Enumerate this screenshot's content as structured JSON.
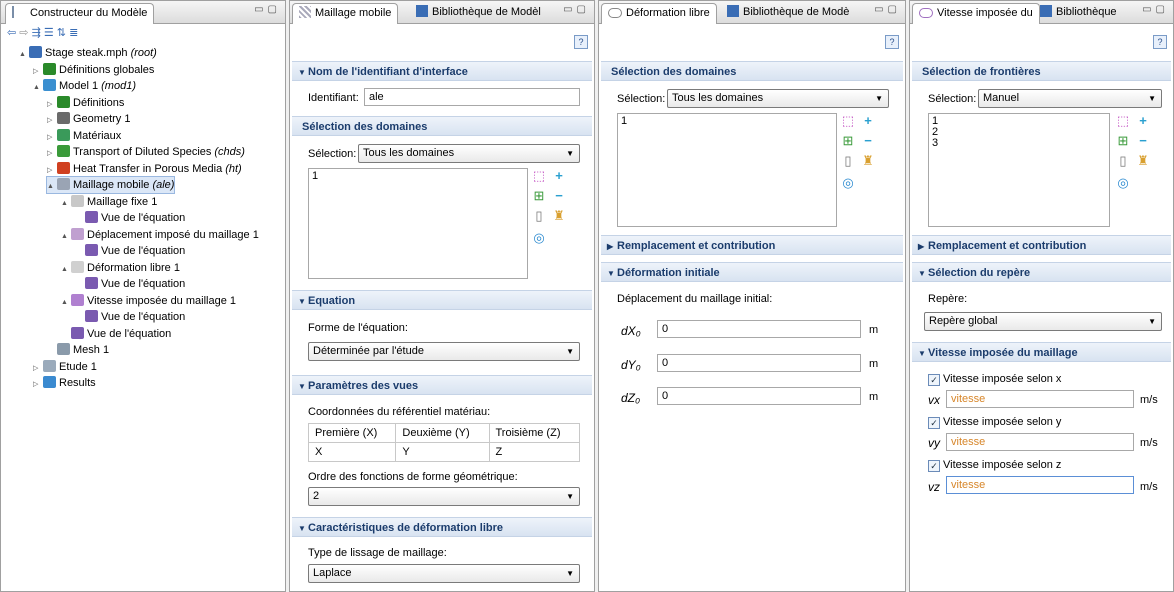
{
  "builder": {
    "title": "Constructeur du Modèle",
    "toolbar_icons": [
      "back-arrow-icon",
      "forward-arrow-icon",
      "expand-icon",
      "collapse-icon",
      "sort-icon",
      "list-icon"
    ],
    "tree": [
      {
        "label": "Stage steak.mph",
        "tag": "(root)",
        "icon": "mph-file-icon"
      },
      {
        "label": "Définitions globales",
        "tag": "",
        "icon": "definitions-icon"
      },
      {
        "label": "Model 1",
        "tag": "(mod1)",
        "icon": "model-icon"
      },
      {
        "label": "Définitions",
        "tag": "",
        "icon": "definitions-icon"
      },
      {
        "label": "Geometry 1",
        "tag": "",
        "icon": "geometry-icon"
      },
      {
        "label": "Matériaux",
        "tag": "",
        "icon": "materials-icon"
      },
      {
        "label": "Transport of Diluted Species",
        "tag": "(chds)",
        "icon": "transport-icon"
      },
      {
        "label": "Heat Transfer in Porous Media",
        "tag": "(ht)",
        "icon": "heat-transfer-icon"
      },
      {
        "label": "Maillage mobile",
        "tag": "(ale)",
        "icon": "moving-mesh-icon"
      },
      {
        "label": "Maillage fixe 1",
        "tag": "",
        "icon": "fixed-mesh-icon"
      },
      {
        "label": "Vue de l'équation",
        "tag": "",
        "icon": "equation-icon"
      },
      {
        "label": "Déplacement imposé du maillage 1",
        "tag": "",
        "icon": "displacement-icon"
      },
      {
        "label": "Vue de l'équation",
        "tag": "",
        "icon": "equation-icon"
      },
      {
        "label": "Déformation libre 1",
        "tag": "",
        "icon": "free-deformation-icon"
      },
      {
        "label": "Vue de l'équation",
        "tag": "",
        "icon": "equation-icon"
      },
      {
        "label": "Vitesse imposée du maillage 1",
        "tag": "",
        "icon": "velocity-icon"
      },
      {
        "label": "Vue de l'équation",
        "tag": "",
        "icon": "equation-icon"
      },
      {
        "label": "Vue de l'équation",
        "tag": "",
        "icon": "equation-icon"
      },
      {
        "label": "Mesh 1",
        "tag": "",
        "icon": "mesh-icon"
      },
      {
        "label": "Etude 1",
        "tag": "",
        "icon": "study-icon"
      },
      {
        "label": "Results",
        "tag": "",
        "icon": "results-icon"
      }
    ]
  },
  "pane2": {
    "tab_active": "Maillage mobile",
    "tab_other": "Bibliothèque de Modèl",
    "sec_interface": "Nom de l'identifiant d'interface",
    "ident_label": "Identifiant:",
    "ident_value": "ale",
    "sec_domains": "Sélection des domaines",
    "sel_label": "Sélection:",
    "sel_value": "Tous les domaines",
    "domains": "1",
    "sec_equation": "Equation",
    "form_label": "Forme de l'équation:",
    "form_value": "Déterminée par l'étude",
    "sec_params": "Paramètres des vues",
    "coord_label": "Coordonnées du référentiel matériau:",
    "coord_headers": [
      "Première (X)",
      "Deuxième (Y)",
      "Troisième (Z)"
    ],
    "coord_values": [
      "X",
      "Y",
      "Z"
    ],
    "order_label": "Ordre des fonctions de forme géométrique:",
    "order_value": "2",
    "sec_free": "Caractéristiques de déformation libre",
    "smooth_label": "Type de lissage de maillage:",
    "smooth_value": "Laplace"
  },
  "pane3": {
    "tab_active": "Déformation libre",
    "tab_other": "Bibliothèque de Modè",
    "sec_domains": "Sélection des domaines",
    "sel_label": "Sélection:",
    "sel_value": "Tous les domaines",
    "domains": "1",
    "sec_replace": "Remplacement et contribution",
    "sec_initial": "Déformation initiale",
    "disp_label": "Déplacement du maillage initial:",
    "dx_label": "dX₀",
    "dy_label": "dY₀",
    "dz_label": "dZ₀",
    "dx": "0",
    "dy": "0",
    "dz": "0",
    "unit": "m"
  },
  "pane4": {
    "tab_active": "Vitesse imposée du",
    "tab_other": "Bibliothèque",
    "sec_boundaries": "Sélection de frontières",
    "sel_label": "Sélection:",
    "sel_value": "Manuel",
    "boundaries": [
      "1",
      "2",
      "3"
    ],
    "sec_replace": "Remplacement et contribution",
    "sec_frame": "Sélection du repère",
    "frame_label": "Repère:",
    "frame_value": "Repère global",
    "sec_velocity": "Vitesse imposée du maillage",
    "chk_x": "Vitesse imposée selon x",
    "chk_y": "Vitesse imposée selon y",
    "chk_z": "Vitesse imposée selon z",
    "vx_label": "vx",
    "vy_label": "vy",
    "vz_label": "vz",
    "vx": "vitesse",
    "vy": "vitesse",
    "vz": "vitesse",
    "unit": "m/s"
  },
  "colors": {
    "section_text": "#1b3c6c",
    "expression": "#d7862a"
  }
}
